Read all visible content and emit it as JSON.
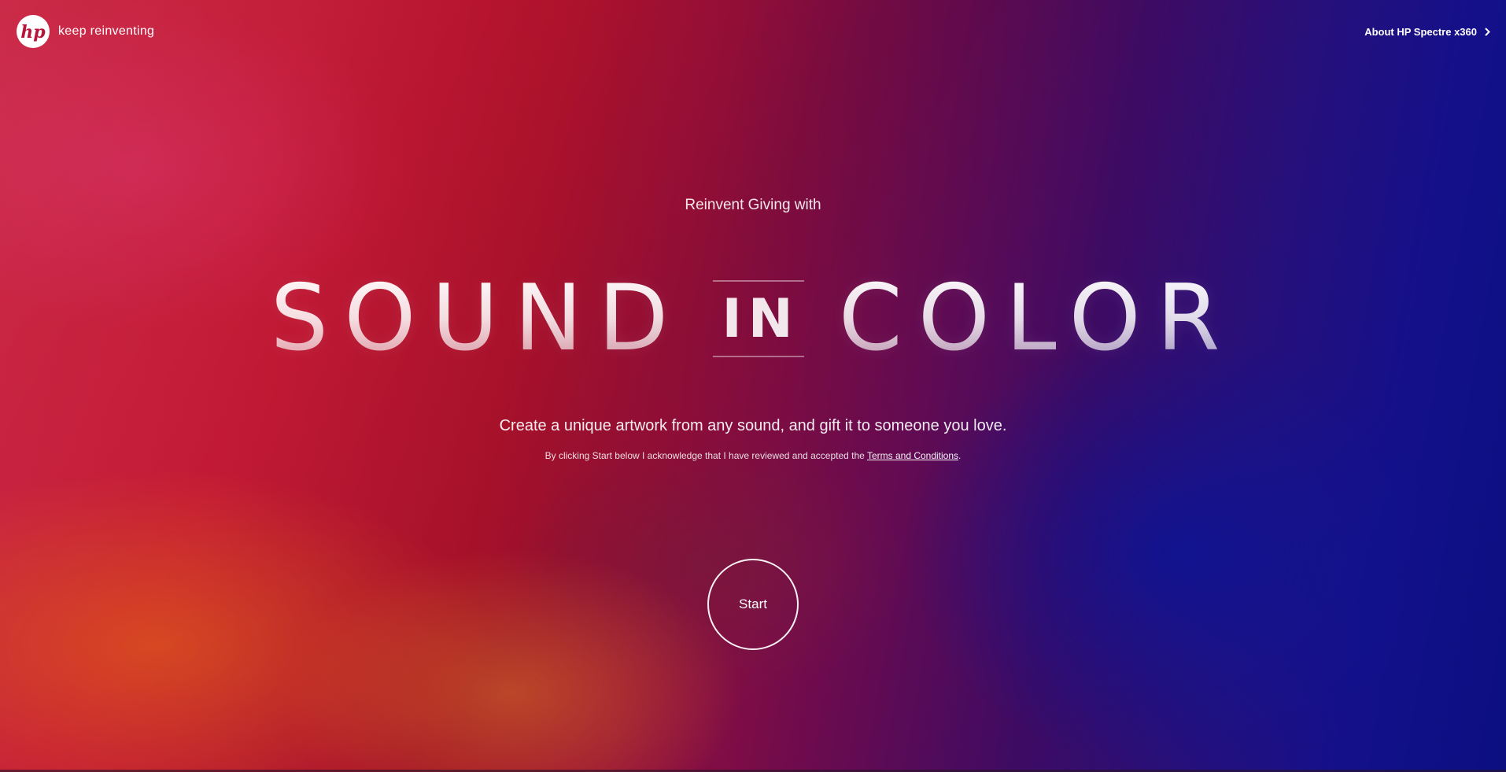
{
  "header": {
    "logo_text": "hp",
    "tagline": "keep reinventing",
    "about_link": "About HP Spectre x360"
  },
  "hero": {
    "subtitle": "Reinvent Giving with",
    "title_word_1": "SOUND",
    "title_connector": "IN",
    "title_word_2": "COLOR",
    "description": "Create a unique artwork from any sound, and gift it to someone you love.",
    "disclaimer_prefix": "By clicking Start below I acknowledge that I have reviewed and accepted the ",
    "terms_link": "Terms and Conditions",
    "disclaimer_suffix": ".",
    "start_button": "Start"
  },
  "icons": {
    "logo": "hp-logo-icon",
    "about_chevron": "chevron-right-icon"
  },
  "colors": {
    "background_left": "#c8203e",
    "background_right": "#0b0f80",
    "text": "#ffffff"
  }
}
